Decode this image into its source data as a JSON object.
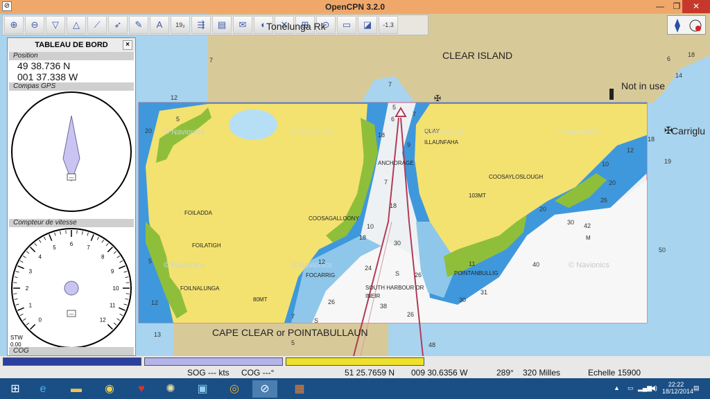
{
  "window": {
    "title": "OpenCPN 3.2.0"
  },
  "toolbar": {
    "tooltip": "Tonelunga Rk",
    "buttons": [
      {
        "icon": "zoom-in-icon",
        "glyph": "⊕"
      },
      {
        "icon": "zoom-out-icon",
        "glyph": "⊖"
      },
      {
        "icon": "chart-scale-down-icon",
        "glyph": "▽"
      },
      {
        "icon": "chart-scale-up-icon",
        "glyph": "△"
      },
      {
        "icon": "route-icon",
        "glyph": "⟋"
      },
      {
        "icon": "follow-boat-icon",
        "glyph": "➶"
      },
      {
        "icon": "measure-icon",
        "glyph": "✎"
      },
      {
        "icon": "north-up-icon",
        "glyph": "A"
      },
      {
        "icon": "tide-icon",
        "glyph": "19₂"
      },
      {
        "icon": "current-icon",
        "glyph": "⇶"
      },
      {
        "icon": "print-icon",
        "glyph": "▤"
      },
      {
        "icon": "route-manager-icon",
        "glyph": "✉"
      },
      {
        "icon": "ais-icon",
        "glyph": "◐"
      },
      {
        "icon": "settings-icon",
        "glyph": "✕"
      },
      {
        "icon": "track-icon",
        "glyph": "⊞"
      },
      {
        "icon": "mob-icon",
        "glyph": "⊙"
      },
      {
        "icon": "layers-icon",
        "glyph": "▭"
      },
      {
        "icon": "plugin-icon",
        "glyph": "◪"
      },
      {
        "icon": "quick-scale-button",
        "glyph": "-1.3"
      }
    ]
  },
  "dashboard": {
    "title": "TABLEAU DE BORD",
    "close": "×",
    "position_label": "Position",
    "lat": "49 38.736 N",
    "lon": "001 37.338 W",
    "compass_label": "Compas GPS",
    "compass_value": "---",
    "speed_label": "Compteur de vitesse",
    "speed_ticks": [
      "0",
      "1",
      "2",
      "3",
      "4",
      "5",
      "6",
      "7",
      "8",
      "9",
      "10",
      "11",
      "12"
    ],
    "speed_value": "---",
    "stw_label": "STW",
    "stw_value": "0.00",
    "cog_label": "COG"
  },
  "chart": {
    "labels": {
      "clear_island": "CLEAR ISLAND",
      "not_in_use": "Not in use",
      "carrigl": "Carriglu",
      "cape_clear": "CAPE CLEAR or POINTABULLAUN",
      "quay": "QUAY",
      "illaunfaha": "ILLAUNFAHA",
      "anchorage": "ANCHORAGE",
      "coosaylosl": "COOSAYLOSLOUGH",
      "foiladda": "FOILADDA",
      "coosagalloony": "COOSAGALLOONY",
      "foilatigh": "FOILATIGH",
      "foilnalunga": "FOILNALUNGA",
      "focarrig": "FOCARRIG",
      "south_harbour": "SOUTH HARBOUR OR",
      "ineir": "INEIR",
      "pointanbullig": "POINTANBULLIG",
      "mt80": "80MT",
      "mt103": "103MT",
      "m_label": "M",
      "watermark": "© Navionics"
    },
    "soundings": [
      "7",
      "3",
      "12",
      "5",
      "1",
      "20",
      "6",
      "4",
      "9",
      "3",
      "7",
      "5",
      "8",
      "5",
      "6",
      "7",
      "10",
      "18",
      "30",
      "24",
      "26",
      "38",
      "48",
      "31",
      "30",
      "11",
      "40",
      "42",
      "50",
      "26",
      "19",
      "18",
      "14",
      "6",
      "13",
      "8",
      "1",
      "5",
      "S"
    ]
  },
  "statusbar": {
    "sog": "SOG --- kts",
    "cog": "COG ---°",
    "lat": "51 25.7659 N",
    "lon": "009 30.6356 W",
    "bearing": "289°",
    "distance": "320 Milles",
    "scale": "Echelle 15900",
    "bar_colors": [
      "#2a3fa0",
      "#b4b4ea",
      "#efe02a"
    ]
  },
  "taskbar": {
    "time": "22:22",
    "date": "18/12/2014"
  }
}
